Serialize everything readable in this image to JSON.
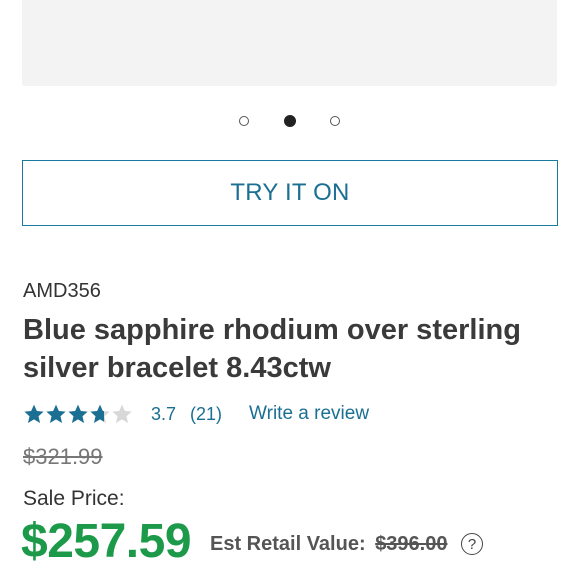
{
  "carousel": {
    "slide_count": 3,
    "active_index": 1
  },
  "try_on": {
    "label": "TRY IT ON"
  },
  "product": {
    "sku": "AMD356",
    "title": "Blue sapphire rhodium over sterling silver bracelet 8.43ctw"
  },
  "rating": {
    "value": "3.7",
    "count": "(21)",
    "write_review": "Write a review",
    "stars_fraction": 0.74
  },
  "pricing": {
    "original_price": "$321.99",
    "sale_label": "Sale Price:",
    "sale_price": "$257.59",
    "retail_label": "Est Retail Value:",
    "retail_value": "$396.00",
    "help_symbol": "?"
  },
  "colors": {
    "accent": "#1a6f93",
    "sale_green": "#1c9a4a",
    "star_fill": "#1a6f93",
    "star_empty": "#d8d8d8"
  }
}
